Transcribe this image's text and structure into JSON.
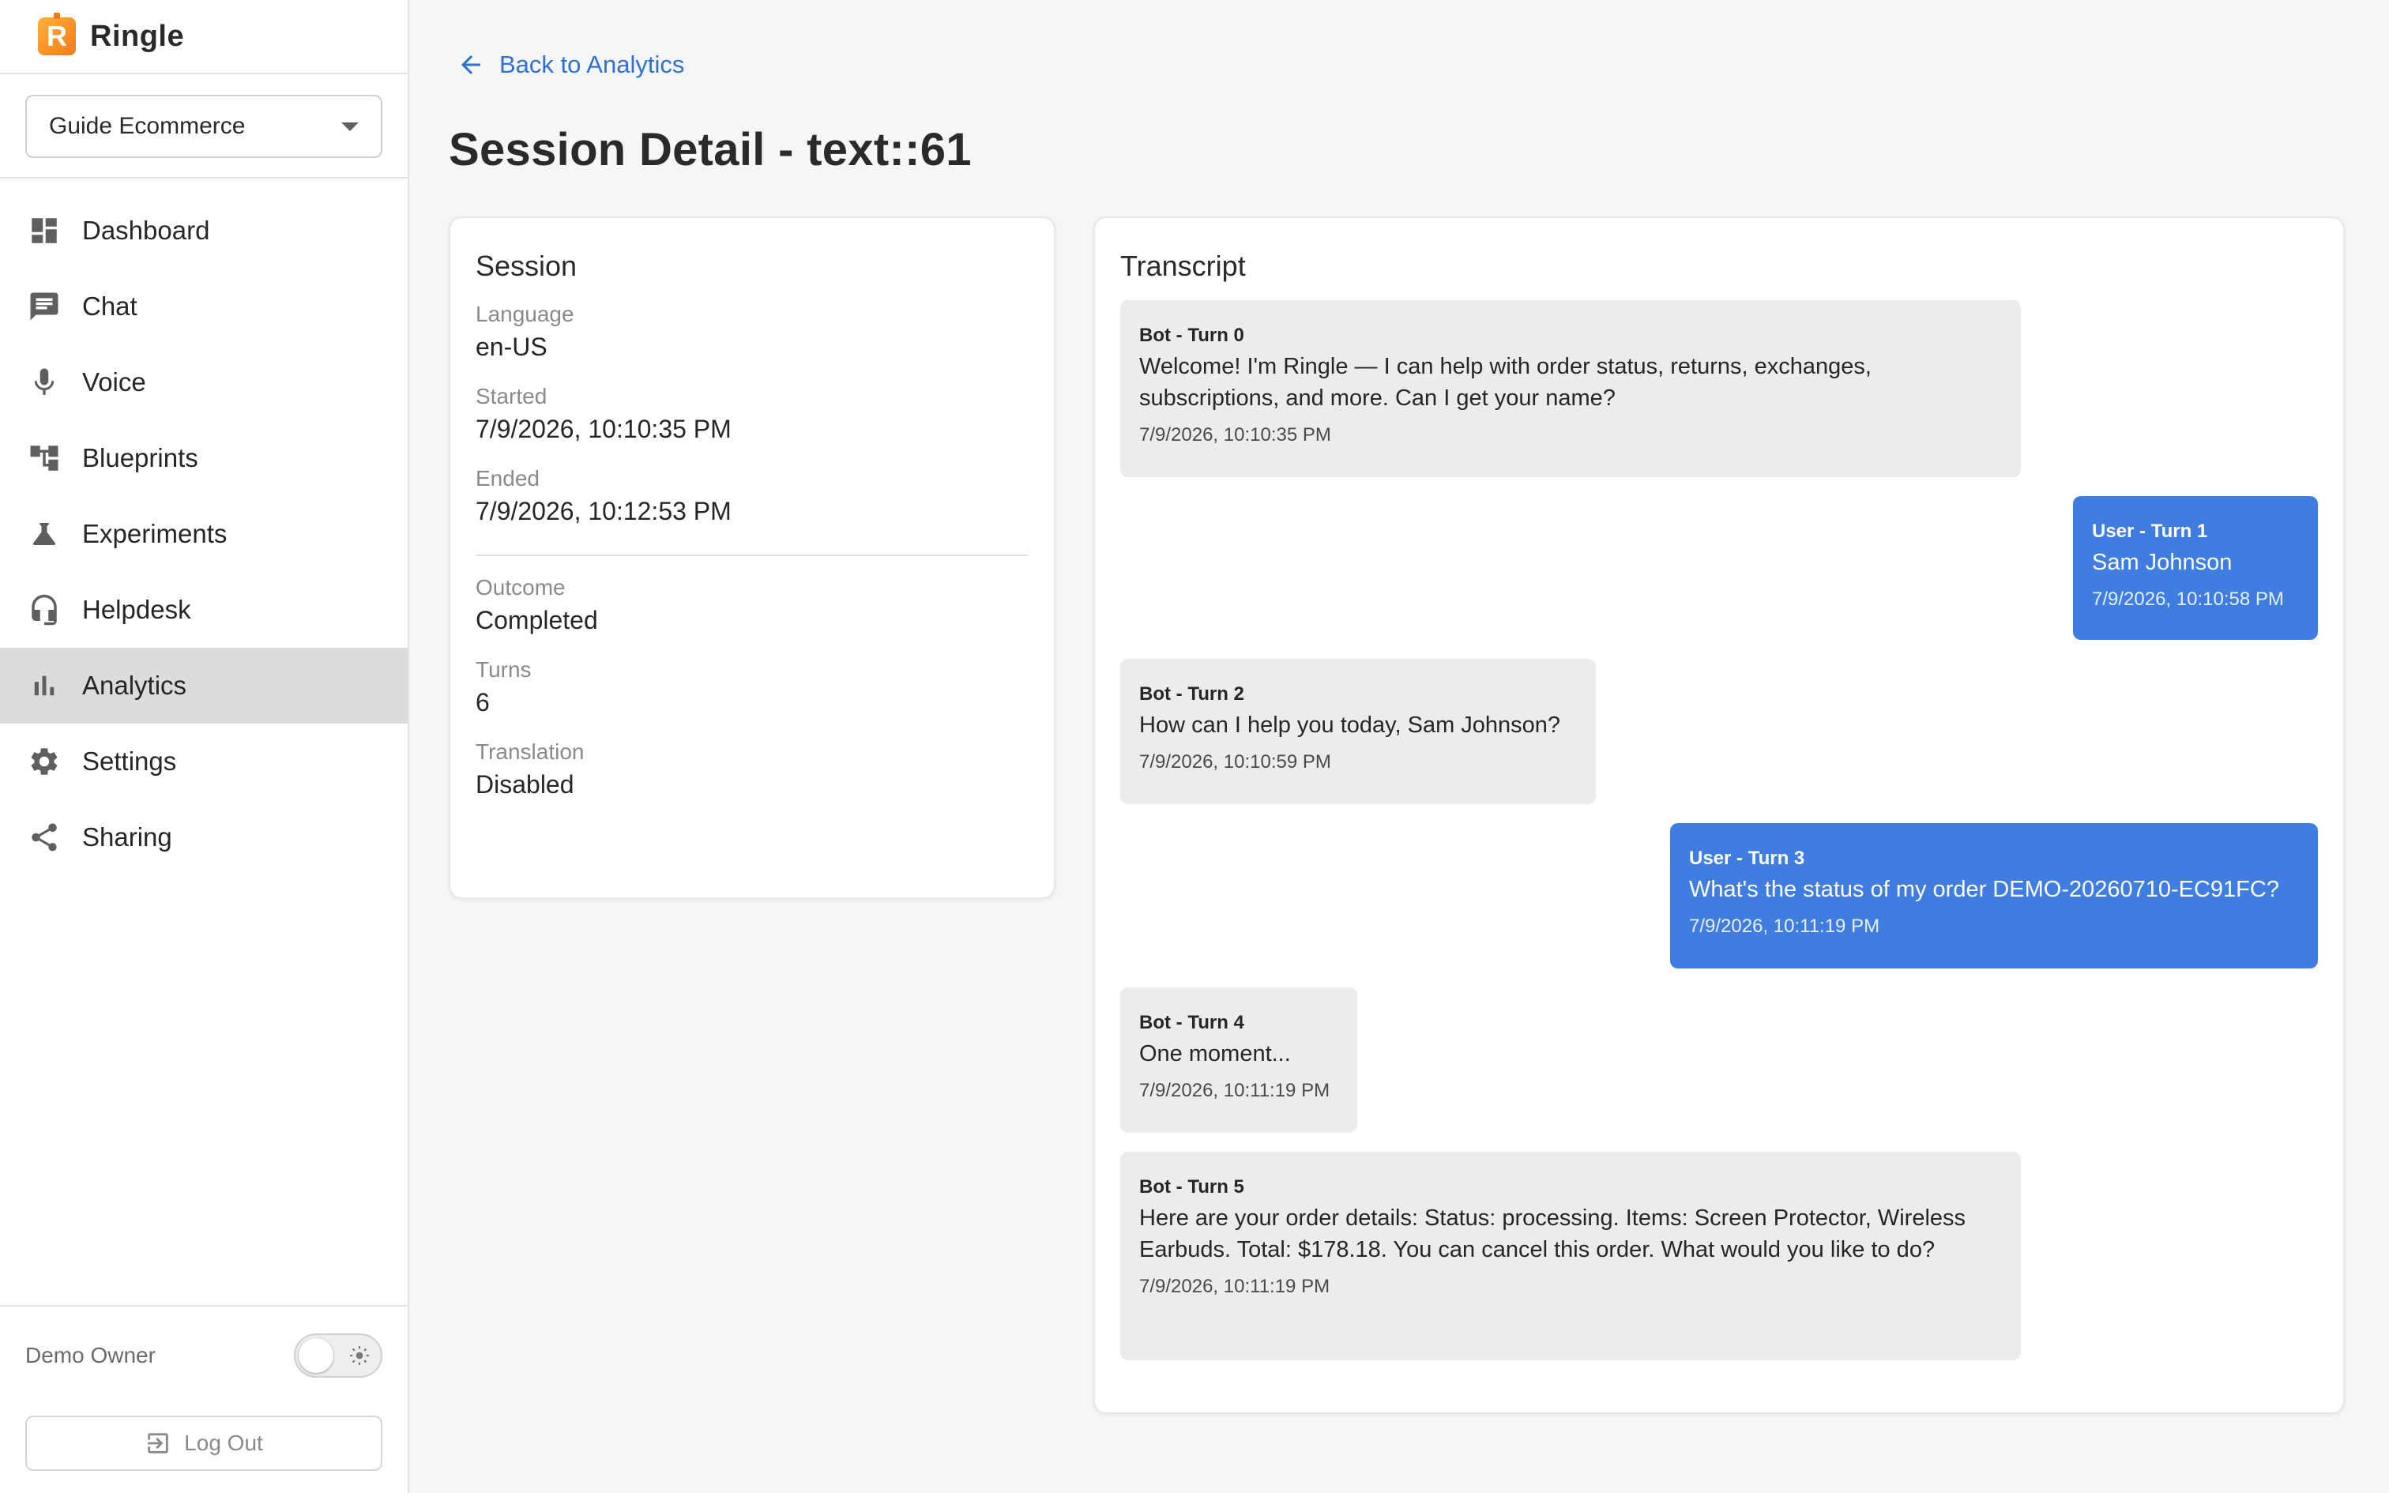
{
  "app": {
    "name": "Ringle",
    "logo_letter": "R"
  },
  "workspace": {
    "selected": "Guide Ecommerce"
  },
  "sidebar": {
    "items": [
      {
        "label": "Dashboard",
        "icon": "dashboard-icon"
      },
      {
        "label": "Chat",
        "icon": "chat-icon"
      },
      {
        "label": "Voice",
        "icon": "mic-icon"
      },
      {
        "label": "Blueprints",
        "icon": "blueprints-icon"
      },
      {
        "label": "Experiments",
        "icon": "flask-icon"
      },
      {
        "label": "Helpdesk",
        "icon": "headset-icon"
      },
      {
        "label": "Analytics",
        "icon": "bar-chart-icon",
        "active": true
      },
      {
        "label": "Settings",
        "icon": "gear-icon"
      },
      {
        "label": "Sharing",
        "icon": "share-icon"
      }
    ],
    "footer": {
      "user": "Demo Owner",
      "logout_label": "Log Out"
    }
  },
  "main": {
    "back_label": "Back to Analytics",
    "title": "Session Detail - text::61",
    "session": {
      "title": "Session",
      "fields": [
        {
          "label": "Language",
          "value": "en-US"
        },
        {
          "label": "Started",
          "value": "7/9/2026, 10:10:35 PM"
        },
        {
          "label": "Ended",
          "value": "7/9/2026, 10:12:53 PM"
        },
        {
          "label": "Outcome",
          "value": "Completed"
        },
        {
          "label": "Turns",
          "value": "6"
        },
        {
          "label": "Translation",
          "value": "Disabled"
        }
      ]
    },
    "transcript": {
      "title": "Transcript",
      "messages": [
        {
          "role": "bot",
          "header": "Bot - Turn 0",
          "text": "Welcome! I'm Ringle — I can help with order status, returns, exchanges, subscriptions, and more. Can I get your name?",
          "time": "7/9/2026, 10:10:35 PM"
        },
        {
          "role": "user",
          "header": "User - Turn 1",
          "text": "Sam Johnson",
          "time": "7/9/2026, 10:10:58 PM"
        },
        {
          "role": "bot",
          "header": "Bot - Turn 2",
          "text": "How can I help you today, Sam Johnson?",
          "time": "7/9/2026, 10:10:59 PM"
        },
        {
          "role": "user",
          "header": "User - Turn 3",
          "text": "What's the status of my order DEMO-20260710-EC91FC?",
          "time": "7/9/2026, 10:11:19 PM"
        },
        {
          "role": "bot",
          "header": "Bot - Turn 4",
          "text": "One moment...",
          "time": "7/9/2026, 10:11:19 PM"
        },
        {
          "role": "bot",
          "header": "Bot - Turn 5",
          "text": "Here are your order details: Status: processing. Items: Screen Protector, Wireless Earbuds. Total: $178.18. You can cancel this order. What would you like to do?",
          "time": "7/9/2026, 10:11:19 PM"
        }
      ]
    }
  },
  "colors": {
    "accent": "#2f6fd6",
    "user_bubble": "#3f7de0",
    "bot_bubble": "#ececec",
    "active_nav": "#dcdcdc",
    "brand": "#f07a1a"
  }
}
